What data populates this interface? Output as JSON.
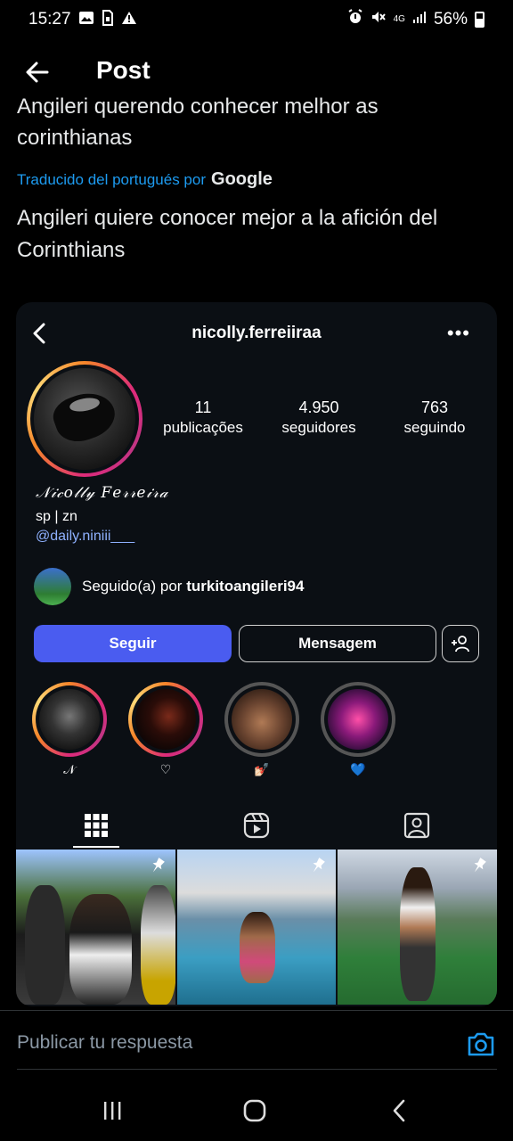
{
  "status_bar": {
    "time": "15:27",
    "network": "4G",
    "battery": "56%",
    "left_icons": [
      "image-icon",
      "sim-icon",
      "warning-icon"
    ],
    "right_icons": [
      "alarm-icon",
      "mute-icon",
      "signal-icon",
      "battery-icon"
    ]
  },
  "header": {
    "title": "Post"
  },
  "tweet": {
    "original_text": "Angileri querendo conhecer melhor as corinthianas",
    "translated_by_label": "Traducido del portugués por",
    "translator": "Google",
    "translated_text": "Angileri quiere conocer mejor a la afición del Corinthians"
  },
  "instagram": {
    "username": "nicolly.ferreiiraa",
    "more_label": "•••",
    "stats": [
      {
        "value": "11",
        "label": "publicações"
      },
      {
        "value": "4.950",
        "label": "seguidores"
      },
      {
        "value": "763",
        "label": "seguindo"
      }
    ],
    "bio": {
      "name": "𝒩𝒾𝒸𝑜𝓁𝓁𝓎 𝐹𝑒𝓇𝓇𝑒𝒾𝓇𝒶",
      "line": "sp | zn",
      "link": "@daily.niniii___"
    },
    "followed_by": {
      "prefix": "Seguido(a) por",
      "user": "turkitoangileri94"
    },
    "buttons": {
      "follow": "Seguir",
      "message": "Mensagem"
    },
    "highlights": [
      {
        "label": "𝒩"
      },
      {
        "label": "♡"
      },
      {
        "label": "💅🏻"
      },
      {
        "label": "💙"
      }
    ],
    "tabs": [
      "grid-icon",
      "reels-icon",
      "tagged-icon"
    ]
  },
  "reply": {
    "placeholder": "Publicar tu respuesta"
  },
  "colors": {
    "accent": "#1d9bf0",
    "ig_follow": "#4a5cf0",
    "background": "#000000"
  }
}
